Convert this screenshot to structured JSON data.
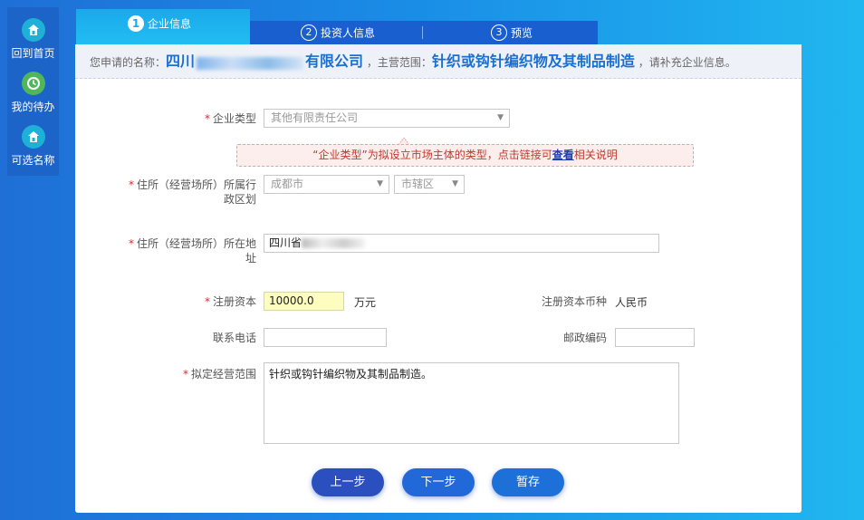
{
  "sidenav": {
    "items": [
      {
        "label": "回到首页",
        "icon": "home-icon"
      },
      {
        "label": "我的待办",
        "icon": "clock-icon"
      },
      {
        "label": "可选名称",
        "icon": "home-icon"
      }
    ]
  },
  "steps": [
    {
      "num": "1",
      "label": "企业信息",
      "active": true
    },
    {
      "num": "2",
      "label": "投资人信息",
      "active": false
    },
    {
      "num": "3",
      "label": "预览",
      "active": false
    }
  ],
  "summary": {
    "name_label": "您申请的名称：",
    "name_prefix": "四川",
    "name_suffix": "有限公司",
    "scope_label": "，主营范围：",
    "scope_value": "针织或钩针编织物及其制品制造",
    "tail": "，请补充企业信息。"
  },
  "form": {
    "company_type": {
      "label": "企业类型",
      "value": "其他有限责任公司"
    },
    "hint": {
      "text_before": "“企业类型”为拟设立市场主体的类型，点击链接可",
      "link": "查看",
      "text_after": "相关说明"
    },
    "region": {
      "label_line1": "住所（经营场所）所属行",
      "label_line2": "政区划",
      "city": "成都市",
      "district": "市辖区"
    },
    "address": {
      "label_line1": "住所（经营场所）所在地",
      "label_line2": "址",
      "value_prefix": "四川省"
    },
    "capital": {
      "label": "注册资本",
      "value": "10000.0",
      "unit": "万元"
    },
    "currency": {
      "label": "注册资本币种",
      "value": "人民币"
    },
    "phone": {
      "label": "联系电话",
      "value": ""
    },
    "postcode": {
      "label": "邮政编码",
      "value": ""
    },
    "scope": {
      "label": "拟定经营范围",
      "value": "针织或钩针编织物及其制品制造。"
    }
  },
  "buttons": {
    "prev": "上一步",
    "next": "下一步",
    "save": "暂存"
  },
  "colors": {
    "accent": "#1a6fd0",
    "required": "#e0262d",
    "hint_bg": "#fdeeee"
  }
}
